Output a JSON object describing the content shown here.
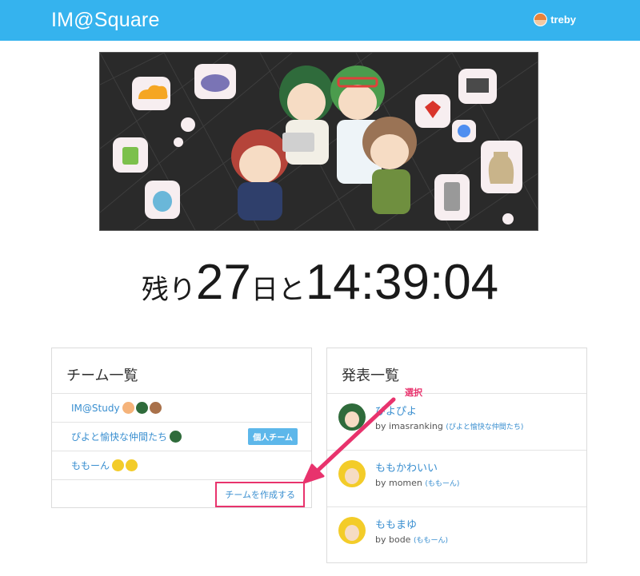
{
  "navbar": {
    "brand": "IM@Square",
    "user_name": "treby"
  },
  "countdown": {
    "prefix": "残り",
    "days": "27",
    "day_unit": "日と",
    "time": "14:39:04"
  },
  "teams": {
    "title": "チーム一覧",
    "items": [
      {
        "name": "IM@Study",
        "avatars": [
          "orange",
          "green",
          "brown"
        ],
        "badge": ""
      },
      {
        "name": "ぴよと愉快な仲間たち",
        "avatars": [
          "green"
        ],
        "badge": "個人チーム"
      },
      {
        "name": "ももーん",
        "avatars": [
          "yellow",
          "yellow"
        ],
        "badge": ""
      }
    ],
    "create_label": "チームを作成する"
  },
  "talks": {
    "title": "発表一覧",
    "items": [
      {
        "title": "ぴよぴよ",
        "by": "by imasranking",
        "team": "(ぴよと愉快な仲間たち)"
      },
      {
        "title": "ももかわいい",
        "by": "by momen",
        "team": "(ももーん)"
      },
      {
        "title": "ももまゆ",
        "by": "by bode",
        "team": "(ももーん)"
      }
    ]
  },
  "annotation": {
    "label": "選択",
    "color": "#e8336d"
  },
  "colors": {
    "navbar": "#35b3ee",
    "link": "#3a8fd0",
    "badge": "#5db7ea"
  }
}
